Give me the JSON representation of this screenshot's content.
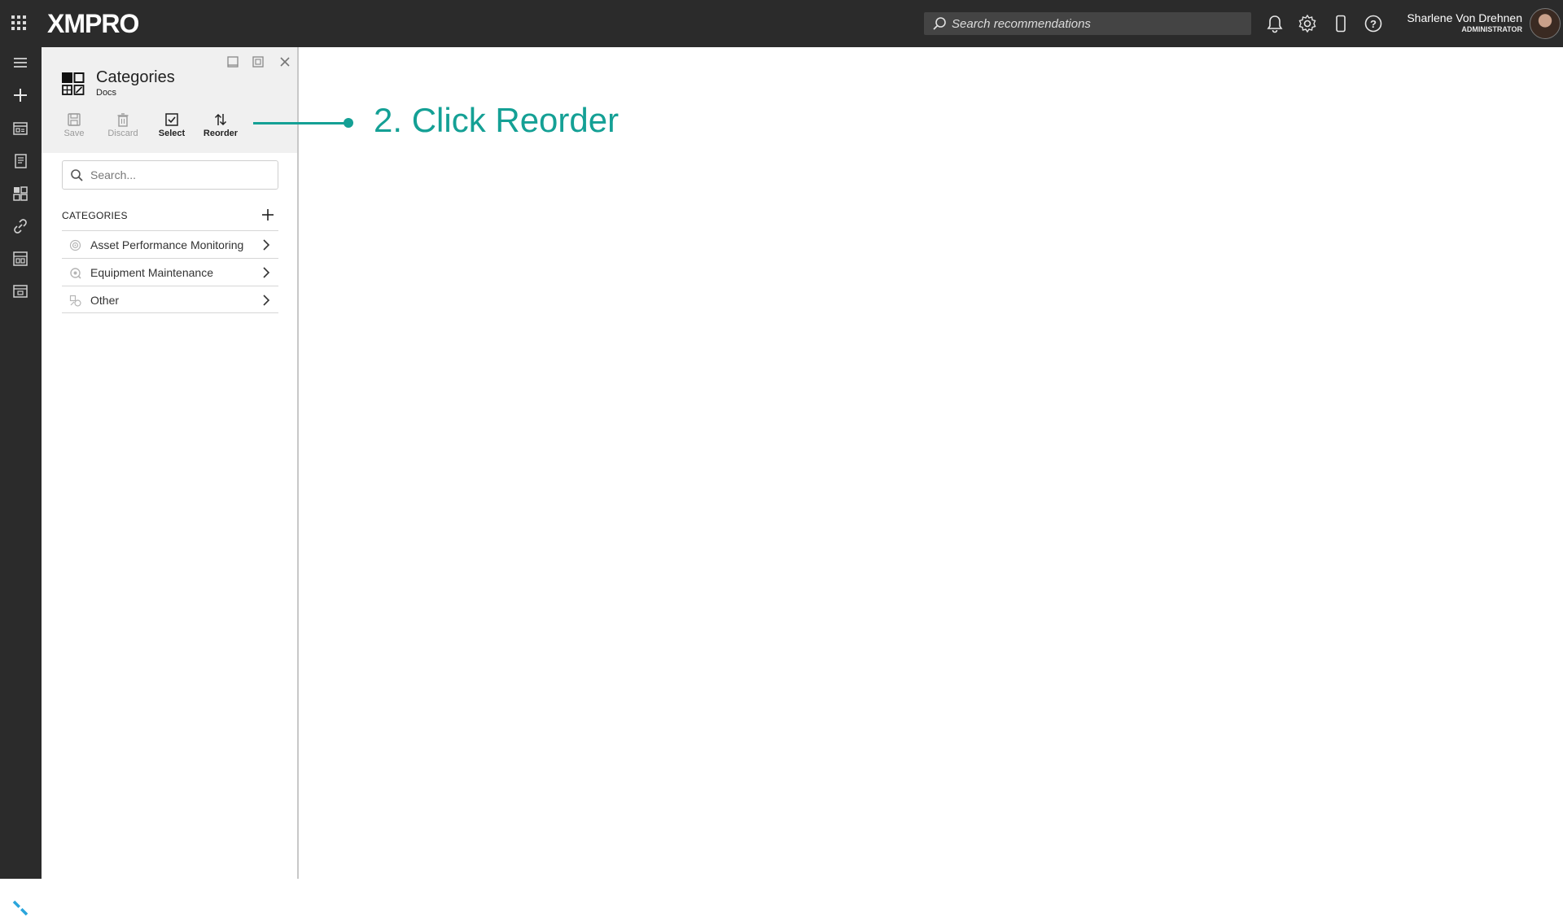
{
  "app": {
    "logo_text": "XMPRO",
    "search_placeholder": "Search recommendations",
    "user": {
      "name": "Sharlene Von Drehnen",
      "role": "ADMINISTRATOR"
    },
    "top_icons": [
      "bell-icon",
      "gear-icon",
      "mobile-icon",
      "help-icon"
    ]
  },
  "rail": {
    "icons": [
      "hamburger-icon",
      "plus-icon",
      "dashboard-icon",
      "notebook-icon",
      "grid-icon",
      "link-icon",
      "layout-icon",
      "app-window-icon",
      "xmpro-x-icon"
    ]
  },
  "panel": {
    "title": "Categories",
    "subtitle": "Docs",
    "toolbar": {
      "save_label": "Save",
      "discard_label": "Discard",
      "select_label": "Select",
      "reorder_label": "Reorder"
    },
    "search_placeholder": "Search...",
    "categories_header": "CATEGORIES",
    "categories": [
      {
        "label": "Asset Performance Monitoring",
        "icon": "monitoring-icon"
      },
      {
        "label": "Equipment Maintenance",
        "icon": "maintenance-icon"
      },
      {
        "label": "Other",
        "icon": "other-icon"
      }
    ]
  },
  "annotation": {
    "text": "2. Click Reorder",
    "color": "#14a095"
  }
}
